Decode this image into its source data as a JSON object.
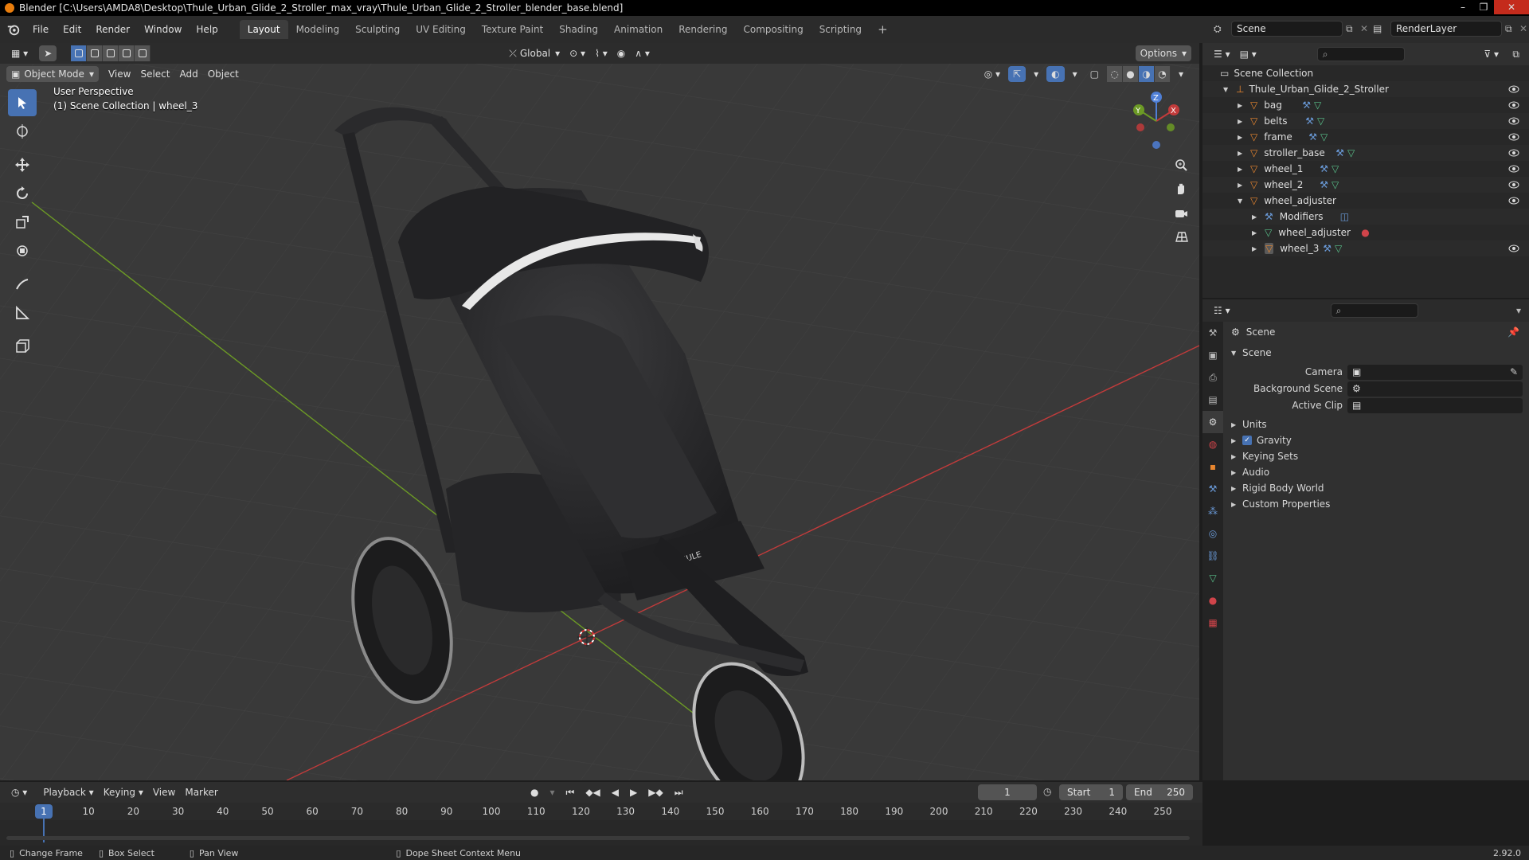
{
  "window": {
    "title": "Blender [C:\\Users\\AMDA8\\Desktop\\Thule_Urban_Glide_2_Stroller_max_vray\\Thule_Urban_Glide_2_Stroller_blender_base.blend]"
  },
  "menu": [
    "File",
    "Edit",
    "Render",
    "Window",
    "Help"
  ],
  "workspaces": [
    "Layout",
    "Modeling",
    "Sculpting",
    "UV Editing",
    "Texture Paint",
    "Shading",
    "Animation",
    "Rendering",
    "Compositing",
    "Scripting"
  ],
  "active_workspace": "Layout",
  "scene_selector": "Scene",
  "view_layer": "RenderLayer",
  "viewport": {
    "transform_orientation": "Global",
    "options_label": "Options",
    "mode": "Object Mode",
    "menus": [
      "View",
      "Select",
      "Add",
      "Object"
    ],
    "perspective_label": "User Perspective",
    "collection_label": "(1) Scene Collection | wheel_3",
    "gizmo_axes": {
      "x": "X",
      "y": "Y",
      "z": "Z"
    }
  },
  "outliner": {
    "root": "Scene Collection",
    "items": [
      {
        "label": "Thule_Urban_Glide_2_Stroller",
        "depth": 1
      },
      {
        "label": "bag",
        "depth": 2
      },
      {
        "label": "belts",
        "depth": 2
      },
      {
        "label": "frame",
        "depth": 2
      },
      {
        "label": "stroller_base",
        "depth": 2
      },
      {
        "label": "wheel_1",
        "depth": 2
      },
      {
        "label": "wheel_2",
        "depth": 2
      },
      {
        "label": "wheel_adjuster",
        "depth": 2
      },
      {
        "label": "Modifiers",
        "depth": 3
      },
      {
        "label": "wheel_adjuster",
        "depth": 3
      },
      {
        "label": "wheel_3",
        "depth": 3
      }
    ]
  },
  "properties": {
    "context": "Scene",
    "panel": "Scene",
    "fields": [
      {
        "label": "Camera",
        "value": ""
      },
      {
        "label": "Background Scene",
        "value": ""
      },
      {
        "label": "Active Clip",
        "value": ""
      }
    ],
    "sections": [
      "Units",
      "Gravity",
      "Keying Sets",
      "Audio",
      "Rigid Body World",
      "Custom Properties"
    ],
    "gravity_checked": true
  },
  "timeline": {
    "menus": [
      "Playback",
      "Keying",
      "View",
      "Marker"
    ],
    "current_frame": "1",
    "start_label": "Start",
    "start": "1",
    "end_label": "End",
    "end": "250",
    "ticks": [
      "1",
      "10",
      "20",
      "30",
      "40",
      "50",
      "60",
      "70",
      "80",
      "90",
      "100",
      "110",
      "120",
      "130",
      "140",
      "150",
      "160",
      "170",
      "180",
      "190",
      "200",
      "210",
      "220",
      "230",
      "240",
      "250"
    ]
  },
  "statusbar": {
    "items": [
      "Change Frame",
      "Box Select",
      "Pan View",
      "Dope Sheet Context Menu"
    ],
    "version": "2.92.0"
  },
  "colors": {
    "accent": "#4772b3",
    "viewport_bg": "#393939",
    "x_axis": "#c23b3b",
    "y_axis": "#6c9a25",
    "object_orange": "#e8862f",
    "mesh_green": "#59c08a"
  }
}
